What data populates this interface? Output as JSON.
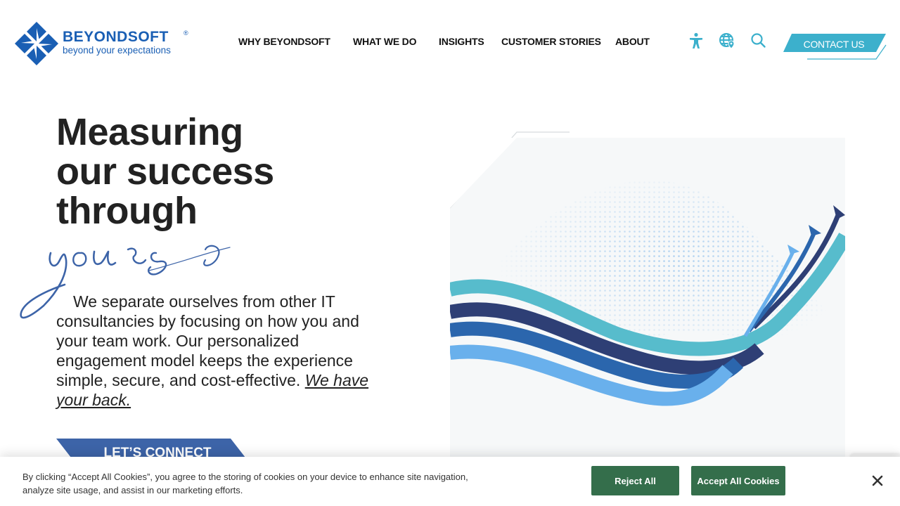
{
  "brand": {
    "name": "BEYONDSOFT",
    "registered_mark": "®",
    "tagline": "beyond your expectations",
    "colors": {
      "primary": "#1a5fb4",
      "accent_teal": "#3cb0cc",
      "connect_blue": "#3d64a8",
      "cookie_green": "#346e4b"
    }
  },
  "nav": {
    "items": [
      {
        "label": "WHY BEYONDSOFT"
      },
      {
        "label": "WHAT WE DO"
      },
      {
        "label": "INSIGHTS"
      },
      {
        "label": "CUSTOMER STORIES"
      },
      {
        "label": "ABOUT"
      }
    ],
    "icons": [
      "accessibility-icon",
      "globe-location-icon",
      "search-icon"
    ],
    "contact_label": "CONTACT US"
  },
  "hero": {
    "headline_lines": [
      "Measuring",
      "our success",
      "through"
    ],
    "script_word": "yours",
    "body": "We separate ourselves from other IT consultancies by focusing on how you and your team work. Our personalized engagement model keeps the experience simple, secure, and cost-effective.",
    "body_link": "We have your back.",
    "cta_label": "LET’S CONNECT"
  },
  "cookie_banner": {
    "text": "By clicking “Accept All Cookies”, you agree to the storing of cookies on your device to enhance site navigation, analyze site usage, and assist in our marketing efforts.",
    "reject_label": "Reject All",
    "accept_label": "Accept All Cookies",
    "close_icon": "close-icon"
  }
}
